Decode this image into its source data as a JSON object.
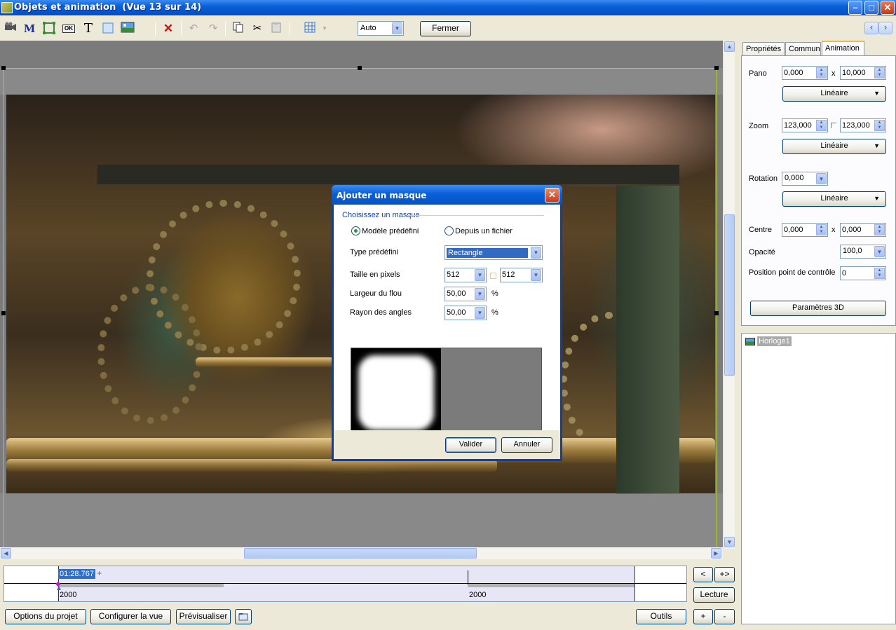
{
  "window": {
    "title": "Objets et animation  (Vue 13 sur 14)",
    "minimize": "–",
    "maximize": "□",
    "close": "✕"
  },
  "toolbar": {
    "icons": [
      "camera-icon",
      "m-text-icon",
      "rectangle-icon",
      "ok-button-icon",
      "text-icon",
      "frame-icon",
      "image-icon",
      "delete-icon",
      "undo-icon",
      "redo-icon",
      "copy-icon",
      "cut-icon",
      "paste-icon",
      "grid-icon"
    ],
    "m_label": "M",
    "t_label": "T",
    "ok_label": "OK",
    "zoom_value": "Auto",
    "close_label": "Fermer",
    "nav_prev": "‹",
    "nav_next": "›"
  },
  "timeline": {
    "time": "01:28.767",
    "plus": "+",
    "label_left": "2000",
    "label_right": "2000",
    "prev_btn": "<",
    "next_btn": "+>",
    "play_btn": "Lecture",
    "add_btn": "+",
    "remove_btn": "-"
  },
  "footer": {
    "project_options": "Options du projet",
    "configure_view": "Configurer la vue",
    "preview": "Prévisualiser",
    "tools": "Outils"
  },
  "panel": {
    "tabs": [
      "Propriétés",
      "Commun",
      "Animation"
    ],
    "active_tab": "Animation",
    "pano_label": "Pano",
    "pano_x": "0,000",
    "pano_sep": "x",
    "pano_y": "10,000",
    "pano_interp": "Linéaire",
    "zoom_label": "Zoom",
    "zoom_x": "123,000",
    "zoom_y": "123,000",
    "zoom_interp": "Linéaire",
    "rotation_label": "Rotation",
    "rotation": "0,000",
    "rotation_interp": "Linéaire",
    "center_label": "Centre",
    "center_x": "0,000",
    "center_sep": "x",
    "center_y": "0,000",
    "opacity_label": "Opacité",
    "opacity": "100,0",
    "control_label": "Position point de contrôle",
    "control_value": "0",
    "params3d": "Paramètres 3D"
  },
  "objects": {
    "items": [
      "Horloge1"
    ]
  },
  "dialog": {
    "title": "Ajouter un masque",
    "close": "✕",
    "group_title": "Choisissez un masque",
    "radio_predef": "Modèle prédéfini",
    "radio_file": "Depuis un fichier",
    "predef_selected": true,
    "type_label": "Type prédéfini",
    "type_value": "Rectangle",
    "size_label": "Taille en pixels",
    "size_w": "512",
    "size_h": "512",
    "blur_label": "Largeur du flou",
    "blur_value": "50,00",
    "blur_unit": "%",
    "radius_label": "Rayon des angles",
    "radius_value": "50,00",
    "radius_unit": "%",
    "ok": "Valider",
    "cancel": "Annuler"
  },
  "colors": {
    "titlebar": "#0a5fd8",
    "selection": "#316ac5",
    "frame": "#b4d21e"
  }
}
